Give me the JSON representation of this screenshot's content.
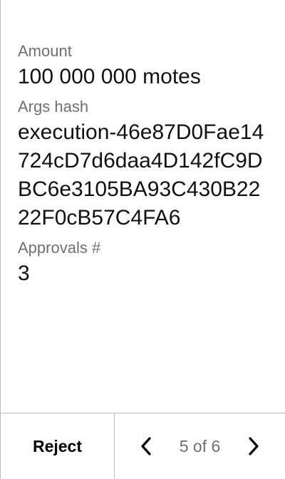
{
  "fields": {
    "amount": {
      "label": "Amount",
      "value": "100 000 000 motes"
    },
    "args_hash": {
      "label": "Args hash",
      "value": "execution-46e87D0Fae14724cD7d6daa4D142fC9DBC6e3105BA93C430B2222F0cB57C4FA6"
    },
    "approvals": {
      "label": "Approvals #",
      "value": "3"
    }
  },
  "footer": {
    "reject_label": "Reject",
    "pagination": {
      "text": "5 of 6"
    },
    "icons": {
      "prev": "chevron-left-icon",
      "next": "chevron-right-icon"
    }
  }
}
